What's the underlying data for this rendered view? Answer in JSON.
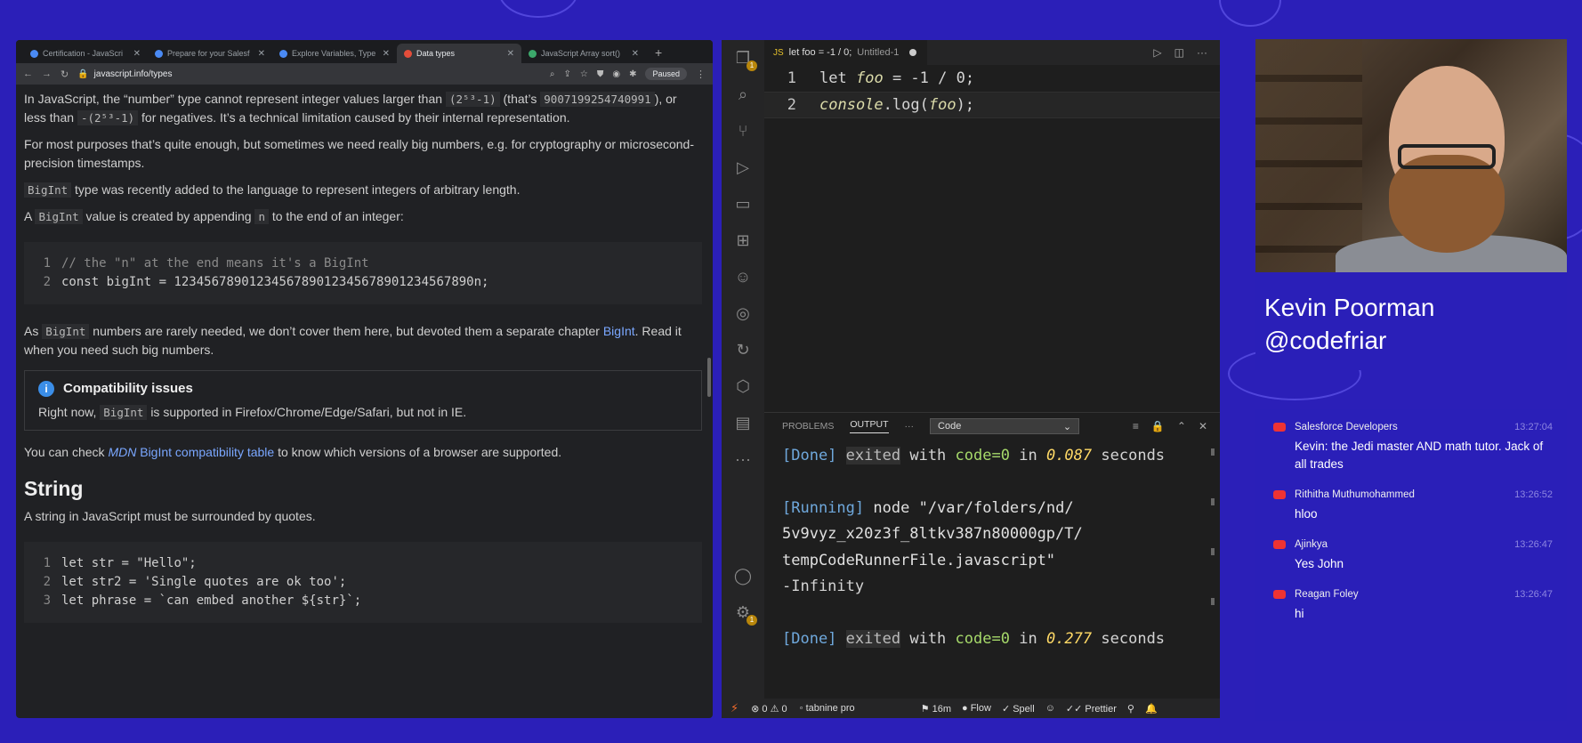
{
  "browser": {
    "tabs": [
      {
        "label": "Certification - JavaScri",
        "active": false
      },
      {
        "label": "Prepare for your Salesf",
        "active": false
      },
      {
        "label": "Explore Variables, Type",
        "active": false
      },
      {
        "label": "Data types",
        "active": true
      },
      {
        "label": "JavaScript Array sort()",
        "active": false
      }
    ],
    "url": "javascript.info/types",
    "paused_label": "Paused"
  },
  "article": {
    "p1_a": "In JavaScript, the “number” type cannot represent integer values larger than",
    "p1_code1": "(2⁵³-1)",
    "p1_b": "(that’s",
    "p1_code2": "9007199254740991",
    "p1_c": "), or less than",
    "p1_code3": "-(2⁵³-1)",
    "p1_d": "for negatives. It’s a technical limitation caused by their internal representation.",
    "p2": "For most purposes that’s quite enough, but sometimes we need really big numbers, e.g. for cryptography or microsecond-precision timestamps.",
    "p3_code": "BigInt",
    "p3": "type was recently added to the language to represent integers of arbitrary length.",
    "p4_a": "A",
    "p4_code": "BigInt",
    "p4_b": "value is created by appending",
    "p4_code2": "n",
    "p4_c": "to the end of an integer:",
    "code1": {
      "line1_num": "1",
      "line1": "// the \"n\" at the end means it's a BigInt",
      "line2_num": "2",
      "line2_kw": "const",
      "line2_rest": "bigInt = 1234567890123456789012345678901234567890n;"
    },
    "p5_a": "As",
    "p5_code": "BigInt",
    "p5_b": "numbers are rarely needed, we don’t cover them here, but devoted them a separate chapter",
    "p5_link": "BigInt",
    "p5_c": ". Read it when you need such big numbers.",
    "callout_title": "Compatibility issues",
    "callout_a": "Right now,",
    "callout_code": "BigInt",
    "callout_b": "is supported in Firefox/Chrome/Edge/Safari, but not in IE.",
    "p6_a": "You can check",
    "p6_link_italic": "MDN",
    "p6_link": "BigInt compatibility table",
    "p6_b": "to know which versions of a browser are supported.",
    "h2": "String",
    "p7": "A string in JavaScript must be surrounded by quotes.",
    "code2": {
      "line1_num": "1",
      "line1_kw": "let",
      "line1_rest": "str = \"Hello\";",
      "line2_num": "2",
      "line2_kw": "let",
      "line2_rest": "str2 = 'Single quotes are ok too';",
      "line3_num": "3",
      "line3_kw": "let",
      "line3_rest": "phrase = `can embed another ${str}`;"
    }
  },
  "vscode": {
    "tab_title": "let foo = -1 / 0;",
    "tab_sub": "Untitled-1",
    "editor": {
      "line1_num": "1",
      "line1_kw": "let",
      "line1_var": "foo",
      "line1_rest": "= -1 / 0;",
      "line2_num": "2",
      "line2_a": "console",
      "line2_b": ".log(",
      "line2_var": "foo",
      "line2_c": ");"
    },
    "panel": {
      "tab_problems": "PROBLEMS",
      "tab_output": "OUTPUT",
      "more": "···",
      "select_value": "Code"
    },
    "output": {
      "done1_a": "[Done]",
      "done1_exited": "exited",
      "done1_b": "with",
      "done1_code": "code=0",
      "done1_in": "in",
      "done1_num": "0.087",
      "done1_sec": "seconds",
      "run_a": "[Running]",
      "run_node": "node",
      "run_path1": "\"/var/folders/nd/",
      "run_path2": "5v9vyz_x20z3f_8ltkv387n80000gp/T/",
      "run_path3": "tempCodeRunnerFile.javascript\"",
      "result": "-Infinity",
      "done2_a": "[Done]",
      "done2_exited": "exited",
      "done2_b": "with",
      "done2_code": "code=0",
      "done2_in": "in",
      "done2_num": "0.277",
      "done2_sec": "seconds"
    },
    "status": {
      "errors": "0",
      "warnings": "0",
      "tabnine": "tabnine pro",
      "time": "16m",
      "flow": "Flow",
      "spell": "Spell",
      "prettier": "Prettier"
    }
  },
  "presenter": {
    "name": "Kevin Poorman",
    "handle": "@codefriar"
  },
  "chat": [
    {
      "author": "Salesforce Developers",
      "time": "13:27:04",
      "text": "Kevin: the Jedi master AND math tutor. Jack of all trades"
    },
    {
      "author": "Rithitha Muthumohammed",
      "time": "13:26:52",
      "text": "hloo"
    },
    {
      "author": "Ajinkya",
      "time": "13:26:47",
      "text": "Yes John"
    },
    {
      "author": "Reagan Foley",
      "time": "13:26:47",
      "text": "hi"
    }
  ]
}
